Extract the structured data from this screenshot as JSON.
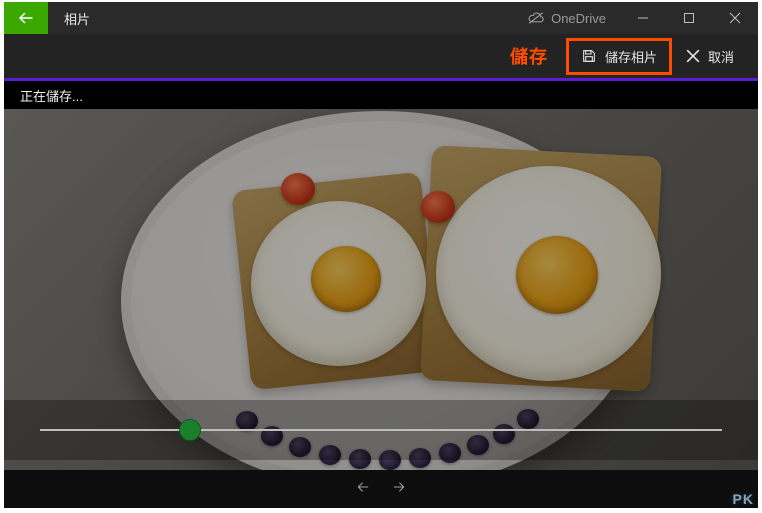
{
  "titlebar": {
    "app_title": "相片",
    "onedrive_label": "OneDrive"
  },
  "toolbar": {
    "save_label": "儲存相片",
    "cancel_label": "取消",
    "annotation": "儲存"
  },
  "status": {
    "saving_text": "正在儲存..."
  },
  "slider": {
    "position_percent": 22
  },
  "watermark": {
    "text_pk": "PK"
  }
}
